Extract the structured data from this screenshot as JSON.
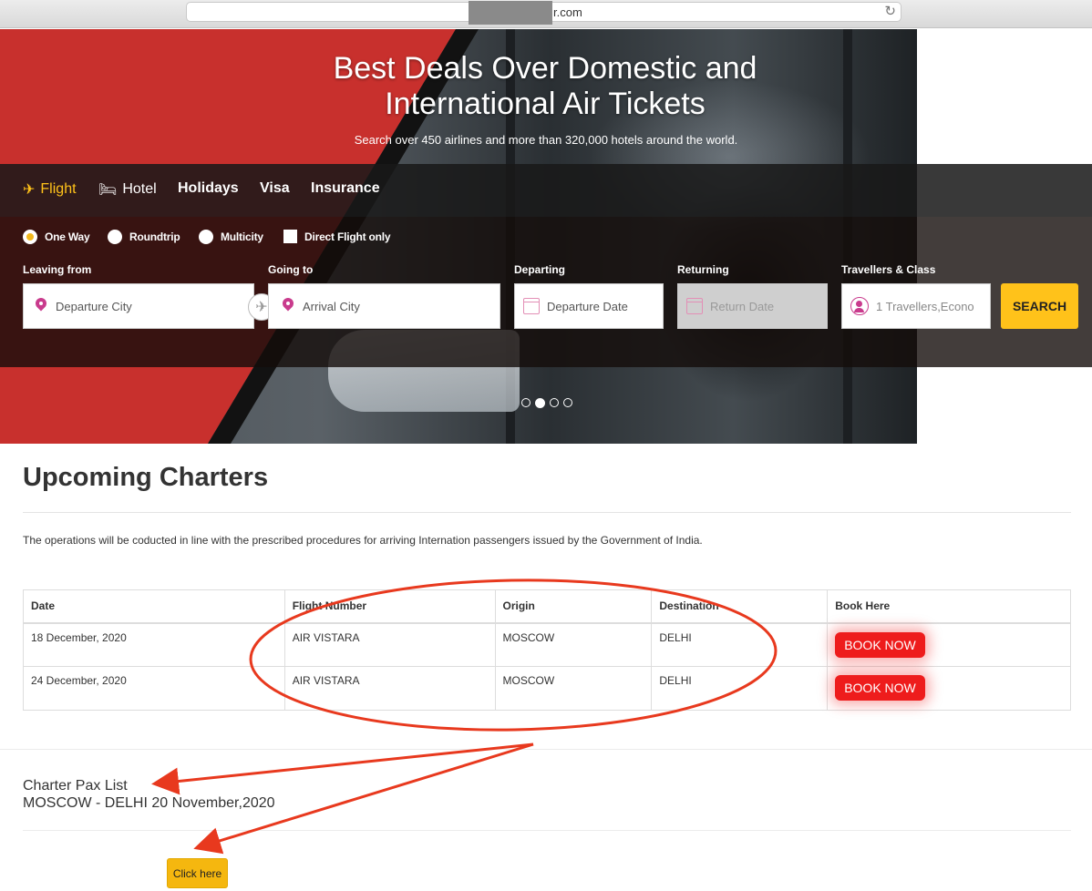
{
  "browser": {
    "url": "r.com"
  },
  "hero": {
    "title_line1": "Best Deals Over Domestic and",
    "title_line2": "International Air Tickets",
    "subtitle": "Search over 450 airlines and more than 320,000 hotels around the world."
  },
  "tabs": [
    {
      "label": "Flight",
      "icon": "plane-icon"
    },
    {
      "label": "Hotel",
      "icon": "bed-icon"
    },
    {
      "label": "Holidays"
    },
    {
      "label": "Visa"
    },
    {
      "label": "Insurance"
    }
  ],
  "trip_options": {
    "one_way": "One Way",
    "roundtrip": "Roundtrip",
    "multicity": "Multicity",
    "direct": "Direct Flight only"
  },
  "search": {
    "from_label": "Leaving from",
    "from_placeholder": "Departure City",
    "to_label": "Going to",
    "to_placeholder": "Arrival City",
    "depart_label": "Departing",
    "depart_placeholder": "Departure Date",
    "return_label": "Returning",
    "return_placeholder": "Return Date",
    "travellers_label": "Travellers & Class",
    "travellers_value": "1 Travellers,Econo",
    "button": "SEARCH"
  },
  "charters": {
    "title": "Upcoming Charters",
    "notice": "The operations will be coducted in line with the prescribed procedures for arriving Internation passengers issued by the Government of India.",
    "headers": [
      "Date",
      "Flight Number",
      "Origin",
      "Destination",
      "Book Here"
    ],
    "rows": [
      {
        "date": "18 December, 2020",
        "flight": "AIR VISTARA",
        "origin": "MOSCOW",
        "destination": "DELHI",
        "action": "BOOK NOW"
      },
      {
        "date": "24 December, 2020",
        "flight": "AIR VISTARA",
        "origin": "MOSCOW",
        "destination": "DELHI",
        "action": "BOOK NOW"
      }
    ]
  },
  "pax": {
    "title": "Charter Pax List",
    "route": "MOSCOW - DELHI 20 November,2020",
    "button": "Click here"
  },
  "colors": {
    "accent": "#ffc21a",
    "hero_red": "#c8302d",
    "book_red": "#ee1c1c",
    "annotation": "#e8391e"
  }
}
